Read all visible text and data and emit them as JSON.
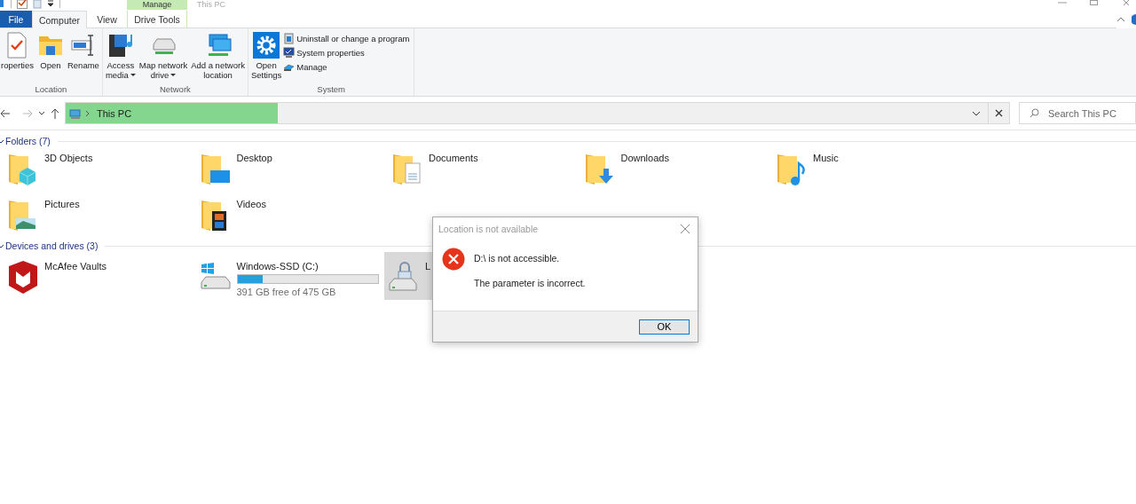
{
  "window": {
    "title": "This PC",
    "contextual_tab": "Manage"
  },
  "tabs": [
    {
      "label": "File",
      "kind": "file",
      "selected": false
    },
    {
      "label": "Computer",
      "kind": "tab",
      "selected": true
    },
    {
      "label": "View",
      "kind": "tab",
      "selected": false
    },
    {
      "label": "Drive Tools",
      "kind": "context",
      "selected": false
    }
  ],
  "ribbon": [
    {
      "label": "Location",
      "items": [
        {
          "kind": "large",
          "lines": [
            "roperties"
          ],
          "dropdown": false
        },
        {
          "kind": "large",
          "lines": [
            "Open"
          ],
          "dropdown": false
        },
        {
          "kind": "large",
          "lines": [
            "Rename"
          ],
          "dropdown": false
        }
      ]
    },
    {
      "label": "Network",
      "items": [
        {
          "kind": "large",
          "lines": [
            "Access",
            "media"
          ],
          "dropdown": true
        },
        {
          "kind": "large",
          "lines": [
            "Map network",
            "drive"
          ],
          "dropdown": true
        },
        {
          "kind": "large",
          "lines": [
            "Add a network",
            "location"
          ],
          "dropdown": false
        }
      ]
    },
    {
      "label": "System",
      "items": [
        {
          "kind": "large",
          "lines": [
            "Open",
            "Settings"
          ],
          "dropdown": false
        },
        {
          "kind": "small",
          "lines": [
            "Uninstall or change a program"
          ]
        },
        {
          "kind": "small",
          "lines": [
            "System properties"
          ]
        },
        {
          "kind": "small",
          "lines": [
            "Manage"
          ]
        }
      ]
    }
  ],
  "address": {
    "path": "This PC",
    "level": 0.23
  },
  "search": {
    "placeholder": "Search This PC"
  },
  "sections": [
    {
      "title": "Folders (7)",
      "kind": "folders",
      "items": [
        {
          "label": "3D Objects"
        },
        {
          "label": "Desktop"
        },
        {
          "label": "Documents"
        },
        {
          "label": "Downloads"
        },
        {
          "label": "Music"
        },
        {
          "label": "Pictures"
        },
        {
          "label": "Videos"
        }
      ]
    },
    {
      "title": "Devices and drives (3)",
      "kind": "drives",
      "items": [
        {
          "label": "McAfee Vaults",
          "selected": false
        },
        {
          "label": "Windows-SSD (C:)",
          "level": 0.18,
          "detail": "391 GB free of 475 GB",
          "selected": false
        },
        {
          "label": "L",
          "selected": true
        }
      ]
    }
  ],
  "dialog": {
    "title": "Location is not available",
    "message": "D:\\ is not accessible.",
    "detail": "The parameter is incorrect.",
    "button": "OK"
  }
}
